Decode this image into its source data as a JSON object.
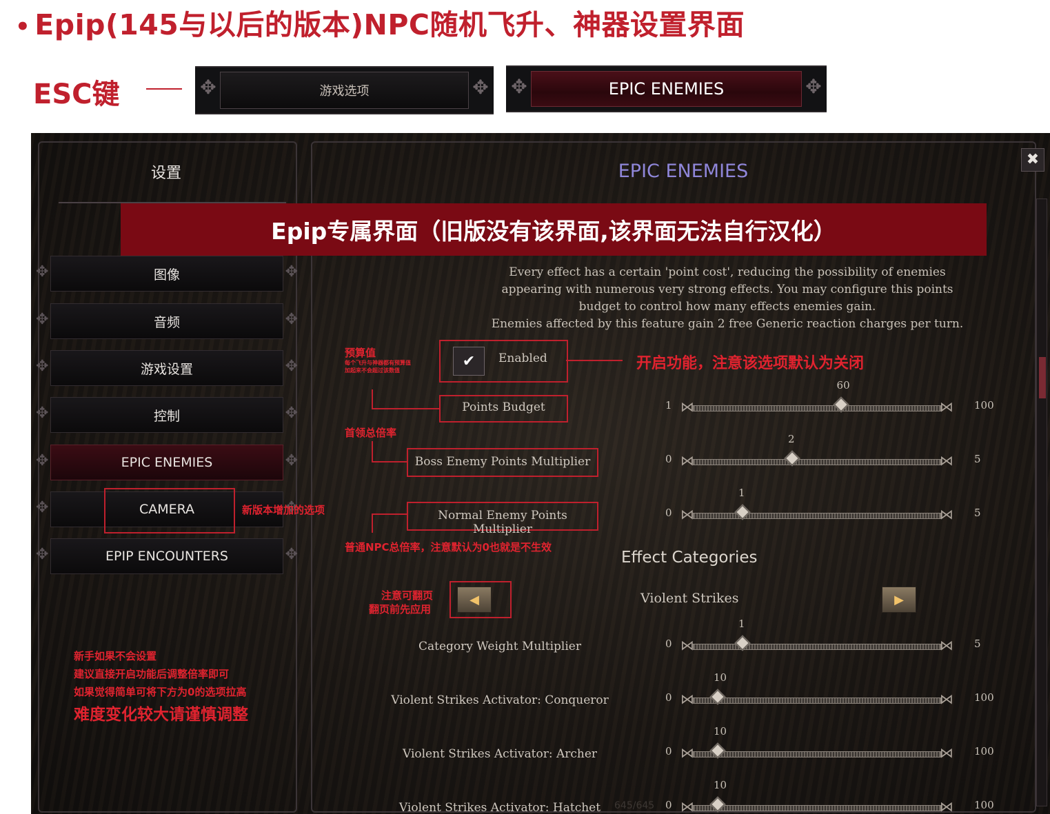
{
  "page_title": "Epip(145与以后的版本)NPC随机飞升、神器设置界面",
  "bullet": "•",
  "esc_label": "ESC键",
  "top_buttons": {
    "game_options": "游戏选项",
    "epic_enemies": "EPIC ENEMIES"
  },
  "sidebar": {
    "title": "设置",
    "items": [
      {
        "label": "图像"
      },
      {
        "label": "音频"
      },
      {
        "label": "游戏设置"
      },
      {
        "label": "控制"
      },
      {
        "label": "EPIC ENEMIES"
      },
      {
        "label": "CAMERA"
      },
      {
        "label": "EPIP ENCOUNTERS"
      }
    ]
  },
  "main": {
    "title": "EPIC ENEMIES",
    "banner": "Epip专属界面（旧版没有该界面,该界面无法自行汉化）",
    "description": [
      "Every effect has a certain 'point cost', reducing the possibility of enemies",
      "appearing with numerous very strong effects. You may configure this points",
      "budget to control how many effects enemies gain.",
      "Enemies affected by this feature gain 2 free Generic reaction charges per turn."
    ],
    "enabled_label": "Enabled",
    "enabled_checked": true,
    "settings": [
      {
        "label": "Points Budget",
        "min": "1",
        "max": "100",
        "value": "60",
        "fraction": 0.596
      },
      {
        "label": "Boss Enemy Points Multiplier",
        "min": "0",
        "max": "5",
        "value": "2",
        "fraction": 0.4
      },
      {
        "label": "Normal Enemy Points Multiplier",
        "min": "0",
        "max": "5",
        "value": "1",
        "fraction": 0.2
      }
    ],
    "effect_categories_title": "Effect Categories",
    "category_name": "Violent Strikes",
    "category_settings": [
      {
        "label": "Category Weight Multiplier",
        "min": "0",
        "max": "5",
        "value": "1",
        "fraction": 0.2
      },
      {
        "label": "Violent Strikes Activator: Conqueror",
        "min": "0",
        "max": "100",
        "value": "10",
        "fraction": 0.1
      },
      {
        "label": "Violent Strikes Activator: Archer",
        "min": "0",
        "max": "100",
        "value": "10",
        "fraction": 0.1
      },
      {
        "label": "Violent Strikes Activator: Hatchet",
        "min": "0",
        "max": "100",
        "value": "10",
        "fraction": 0.1
      }
    ],
    "page_counter": "645/645"
  },
  "annotations": {
    "budget_title": "预算值",
    "budget_note1": "每个飞升与神器都有预算值",
    "budget_note2": "加起来不会超过该数值",
    "enable_note": "开启功能，注意该选项默认为关闭",
    "boss_note": "首领总倍率",
    "camera_note": "新版本增加的选项",
    "normal_note": "普通NPC总倍率，注意默认为0也就是不生效",
    "page_note1": "注意可翻页",
    "page_note2": "翻页前先应用",
    "newbie1": "新手如果不会设置",
    "newbie2": "建议直接开启功能后调整倍率即可",
    "newbie3": "如果觉得简单可将下方为0的选项拉高",
    "newbie4": "难度变化较大请谨慎调整"
  },
  "colors": {
    "accent_red": "#c0202d",
    "banner_red": "#7a0a14",
    "title_purple": "#8f86d9"
  }
}
